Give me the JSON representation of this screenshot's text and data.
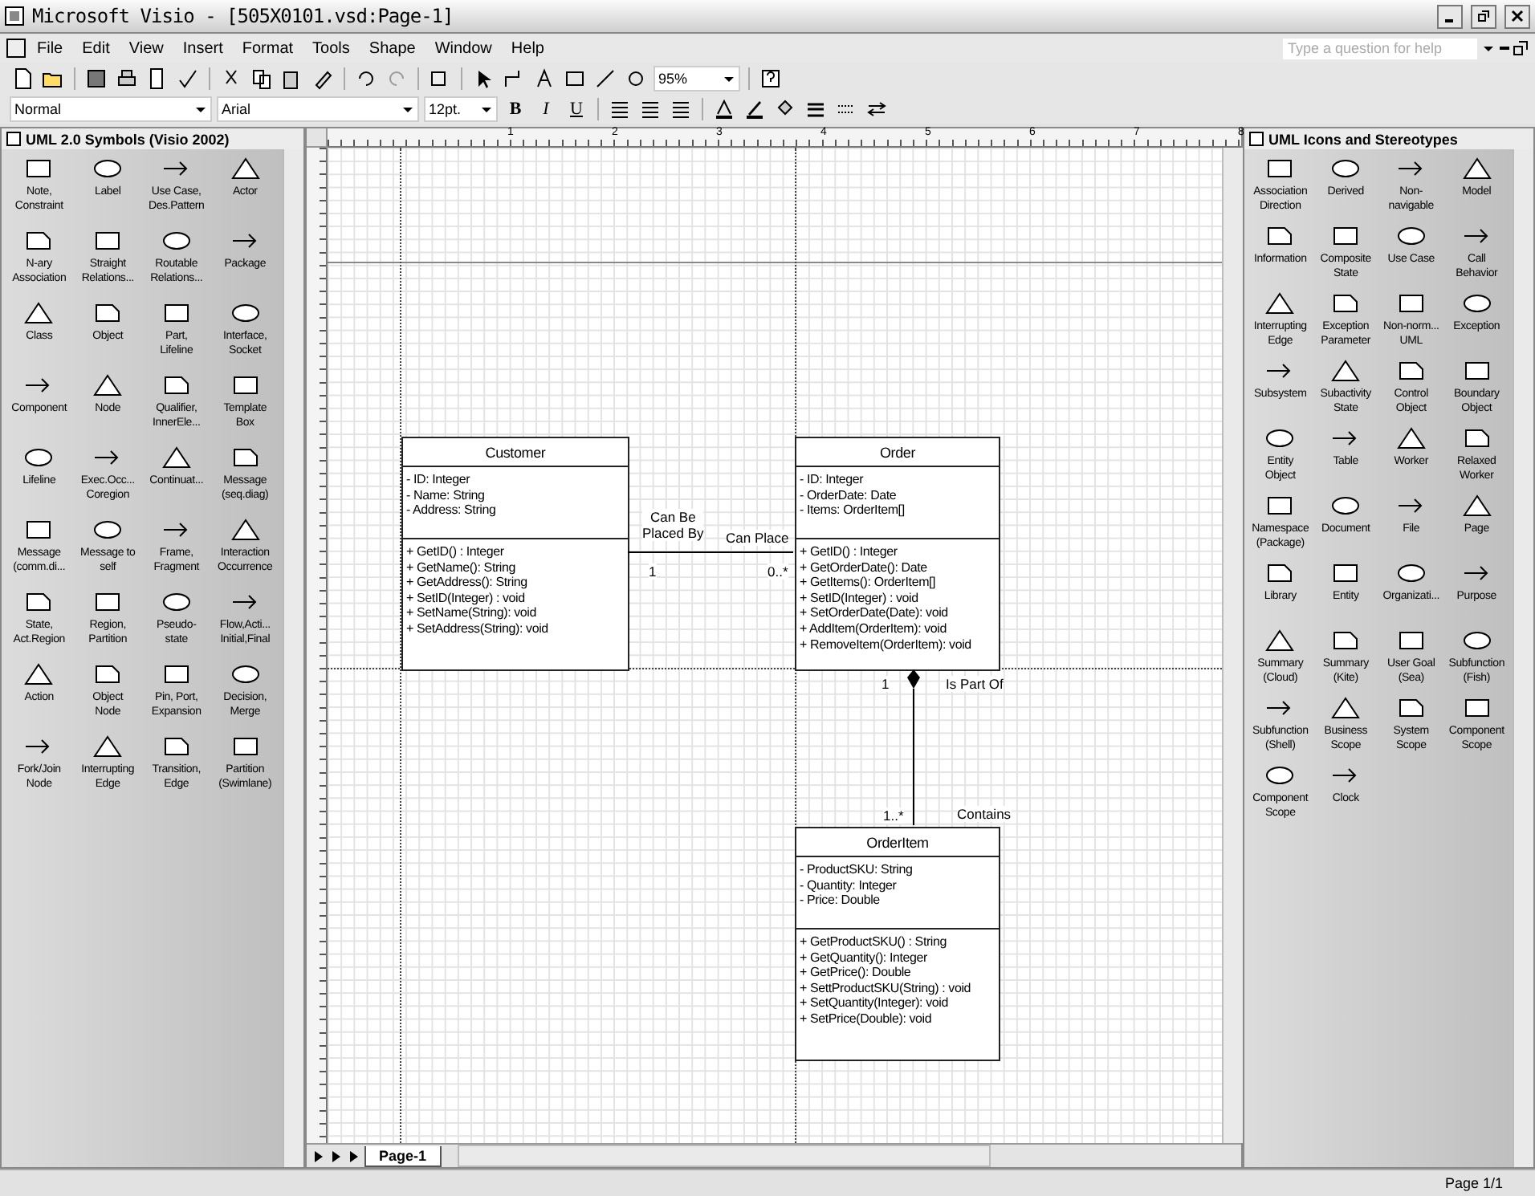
{
  "window": {
    "title": "Microsoft Visio - [505X0101.vsd:Page-1]"
  },
  "menu": [
    "File",
    "Edit",
    "View",
    "Insert",
    "Format",
    "Tools",
    "Shape",
    "Window",
    "Help"
  ],
  "help_box": {
    "placeholder": "Type a question for help"
  },
  "toolbar": {
    "zoom": "95%"
  },
  "format_toolbar": {
    "style": "Normal",
    "font": "Arial",
    "size": "12pt.",
    "styles": [
      "B",
      "I",
      "U"
    ]
  },
  "stencils": [
    {
      "title": "UML 2.0 Symbols (Visio 2002)",
      "items": [
        "Note,\nConstraint",
        "Label",
        "Use Case,\nDes.Pattern",
        "Actor",
        "N-ary\nAssociation",
        "Straight\nRelations...",
        "Routable\nRelations...",
        "Package",
        "Class",
        "Object",
        "Part,\nLifeline",
        "Interface,\nSocket",
        "Component",
        "Node",
        "Qualifier,\nInnerEle...",
        "Template\nBox",
        "Lifeline",
        "Exec.Occ...\nCoregion",
        "Continuat...",
        "Message\n(seq.diag)",
        "Message\n(comm.di...",
        "Message to\nself",
        "Frame,\nFragment",
        "Interaction\nOccurrence",
        "State,\nAct.Region",
        "Region,\nPartition",
        "Pseudo-\nstate",
        "Flow,Acti...\nInitial,Final",
        "Action",
        "Object\nNode",
        "Pin, Port,\nExpansion",
        "Decision,\nMerge",
        "Fork/Join\nNode",
        "Interrupting\nEdge",
        "Transition,\nEdge",
        "Partition\n(Swimlane)"
      ]
    },
    {
      "title": "UML Icons and Stereotypes",
      "items": [
        "Association\nDirection",
        "Derived",
        "Non-\nnavigable",
        "Model",
        "Information",
        "Composite\nState",
        "Use Case",
        "Call\nBehavior",
        "Interrupting\nEdge",
        "Exception\nParameter",
        "Non-norm...\nUML",
        "Exception",
        "Subsystem",
        "Subactivity\nState",
        "Control\nObject",
        "Boundary\nObject",
        "Entity\nObject",
        "Table",
        "Worker",
        "Relaxed\nWorker",
        "Namespace\n(Package)",
        "Document",
        "File",
        "Page",
        "Library",
        "Entity",
        "Organizati...",
        "Purpose",
        "Summary\n(Cloud)",
        "Summary\n(Kite)",
        "User Goal\n(Sea)",
        "Subfunction\n(Fish)",
        "Subfunction\n(Shell)",
        "Business\nScope",
        "System\nScope",
        "Component\nScope",
        "Component\nScope",
        "Clock"
      ]
    }
  ],
  "ruler": {
    "labels": [
      "1",
      "2",
      "3",
      "4",
      "5",
      "6",
      "7",
      "8"
    ]
  },
  "diagram": {
    "classes": [
      {
        "name": "Customer",
        "attributes": [
          "- ID: Integer",
          "- Name: String",
          "- Address: String"
        ],
        "operations": [
          "+ GetID() : Integer",
          "+ GetName(): String",
          "+ GetAddress(): String",
          "+ SetID(Integer) : void",
          "+ SetName(String): void",
          "+ SetAddress(String): void"
        ]
      },
      {
        "name": "Order",
        "attributes": [
          "- ID: Integer",
          "- OrderDate: Date",
          "- Items: OrderItem[]"
        ],
        "operations": [
          "+ GetID() : Integer",
          "+ GetOrderDate(): Date",
          "+ GetItems(): OrderItem[]",
          "+ SetID(Integer) : void",
          "+ SetOrderDate(Date): void",
          "+ AddItem(OrderItem): void",
          "+ RemoveItem(OrderItem): void"
        ]
      },
      {
        "name": "OrderItem",
        "attributes": [
          "- ProductSKU: String",
          "- Quantity: Integer",
          "- Price: Double"
        ],
        "operations": [
          "+ GetProductSKU() : String",
          "+ GetQuantity(): Integer",
          "+ GetPrice(): Double",
          "+ SettProductSKU(String) : void",
          "+ SetQuantity(Integer): void",
          "+ SetPrice(Double): void"
        ]
      }
    ],
    "associations": [
      {
        "kind": "association",
        "labels": [
          "Can Be\nPlaced By",
          "Can Place",
          "1",
          "0..*"
        ]
      },
      {
        "kind": "composition",
        "labels": [
          "1",
          "Is Part Of",
          "1..*",
          "Contains"
        ]
      }
    ]
  },
  "page_tabs": [
    {
      "label": "Page-1",
      "selected": true
    }
  ],
  "status_bar": {
    "page": "Page 1/1"
  }
}
